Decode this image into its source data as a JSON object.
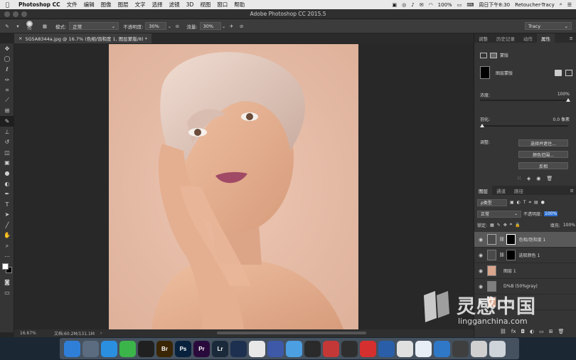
{
  "menubar": {
    "app_name": "Photoshop CC",
    "items": [
      "文件",
      "编辑",
      "图像",
      "图层",
      "文字",
      "选择",
      "滤镜",
      "3D",
      "视图",
      "窗口",
      "帮助"
    ],
    "battery": "100%",
    "clock": "周日下午8:30",
    "user": "Retoucher-Tracy"
  },
  "window": {
    "title": "Adobe Photoshop CC 2015.5"
  },
  "options": {
    "brush_size": "70",
    "mode_label": "模式:",
    "mode_value": "正常",
    "opacity_label": "不透明度:",
    "opacity_value": "30%",
    "flow_label": "流量:",
    "flow_value": "30%",
    "workspace": "Tracy"
  },
  "document": {
    "tab_label": "5G5A8344a.jpg @ 16.7% (色相/饱和度 1, 图层蒙版/8) *",
    "zoom": "16.67%",
    "doc_size": "文档:60.2M/131.1M"
  },
  "tools": [
    "move",
    "marquee",
    "lasso",
    "quick-select",
    "crop",
    "eyedropper",
    "healing",
    "brush",
    "stamp",
    "history-brush",
    "eraser",
    "gradient",
    "blur",
    "dodge",
    "pen",
    "type",
    "path-select",
    "line",
    "hand",
    "zoom",
    "more"
  ],
  "properties_panel": {
    "tabs": [
      "调整",
      "历史记录",
      "动作",
      "属性"
    ],
    "active_tab": "属性",
    "mask_label": "蒙版",
    "layer_mask_label": "图层蒙版",
    "density_label": "浓度:",
    "density_value": "100%",
    "density_fraction": 1.0,
    "feather_label": "羽化:",
    "feather_value": "0.0 像素",
    "feather_fraction": 0.0,
    "refine_label": "调整:",
    "select_mask_button": "选择并遮住...",
    "color_range_button": "颜色范围...",
    "invert_button": "反相"
  },
  "layers_panel": {
    "tabs": [
      "图层",
      "通道",
      "路径"
    ],
    "active_tab": "图层",
    "filter_label": "ρ类型",
    "blend_mode": "正常",
    "opacity_label": "不透明度:",
    "opacity_value": "100%",
    "lock_label": "锁定:",
    "fill_label": "填充:",
    "fill_value": "100%",
    "layers": [
      {
        "name": "色相/饱和度 1",
        "selected": true
      },
      {
        "name": "选取颜色 1",
        "selected": false
      },
      {
        "name": "图层 1",
        "selected": false
      },
      {
        "name": "D%B (50%gray)",
        "selected": false
      },
      {
        "name": "背景",
        "selected": false
      }
    ]
  },
  "watermark": {
    "brand": "灵感中国",
    "url": "lingganchina.com"
  },
  "dock": {
    "apps": [
      {
        "name": "finder",
        "label": "",
        "color": "#2f7fd9"
      },
      {
        "name": "launchpad",
        "label": "",
        "color": "#5b6c80"
      },
      {
        "name": "safari",
        "label": "",
        "color": "#2b8fe0"
      },
      {
        "name": "wechat",
        "label": "",
        "color": "#3bb54a"
      },
      {
        "name": "qq",
        "label": "",
        "color": "#202020"
      },
      {
        "name": "bridge",
        "label": "Br",
        "color": "#3a2504"
      },
      {
        "name": "photoshop",
        "label": "Ps",
        "color": "#08223d"
      },
      {
        "name": "premiere",
        "label": "Pr",
        "color": "#2a0a3c"
      },
      {
        "name": "lightroom",
        "label": "Lr",
        "color": "#1a2a3a"
      },
      {
        "name": "cinema4d",
        "label": "",
        "color": "#1e3050"
      },
      {
        "name": "app-a",
        "label": "",
        "color": "#e8e8e8"
      },
      {
        "name": "app-b",
        "label": "",
        "color": "#3d59a8"
      },
      {
        "name": "app-c",
        "label": "",
        "color": "#4c9fe0"
      },
      {
        "name": "davinci",
        "label": "",
        "color": "#2a2a2a"
      },
      {
        "name": "app-d",
        "label": "",
        "color": "#c43838"
      },
      {
        "name": "app-e",
        "label": "",
        "color": "#2e2e2e"
      },
      {
        "name": "netease-music",
        "label": "",
        "color": "#d62f2f"
      },
      {
        "name": "app-f",
        "label": "",
        "color": "#2a5ea8"
      },
      {
        "name": "app-g",
        "label": "",
        "color": "#e0e0e0"
      },
      {
        "name": "app-h",
        "label": "",
        "color": "#e8eef5"
      },
      {
        "name": "keynote",
        "label": "",
        "color": "#2f78c8"
      },
      {
        "name": "app-i",
        "label": "",
        "color": "#3f3f3f"
      },
      {
        "name": "app-j",
        "label": "",
        "color": "#d0d0d0"
      },
      {
        "name": "trash",
        "label": "",
        "color": "#cfd4da"
      }
    ]
  },
  "colors": {
    "accent": "#2d6fd0",
    "panel_bg": "#353535",
    "canvas_bg": "#282828",
    "skin": "#e3b8a4"
  }
}
